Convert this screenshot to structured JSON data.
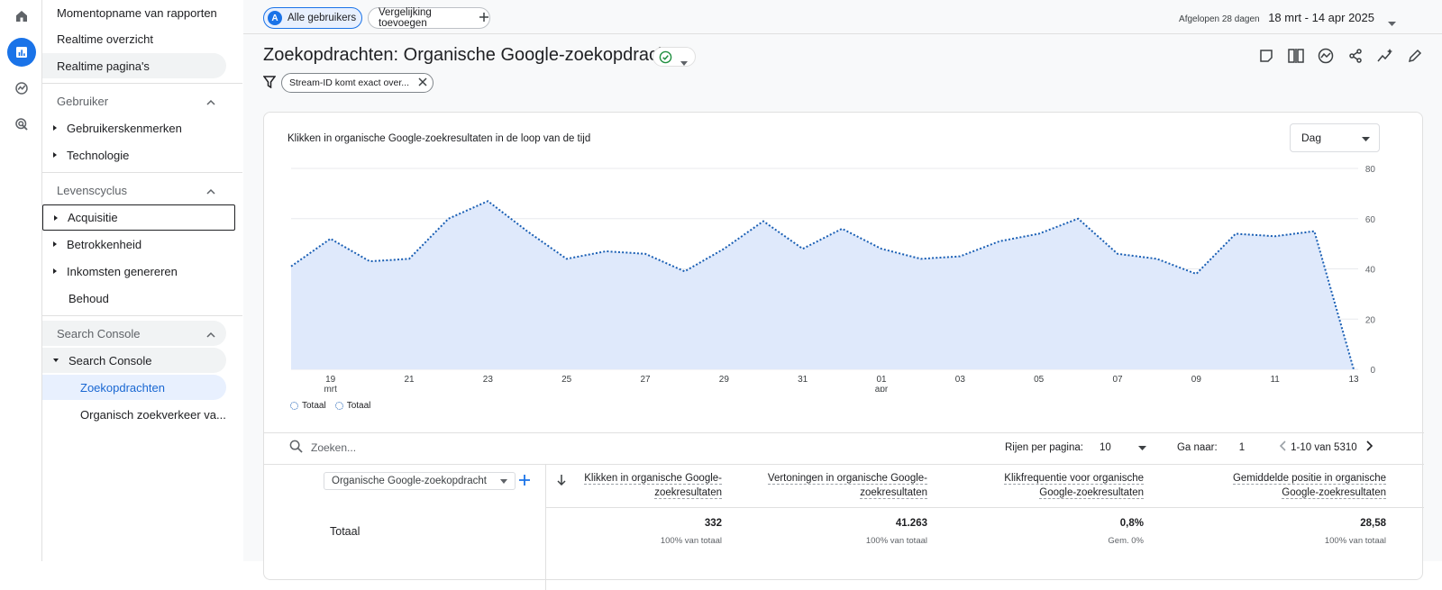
{
  "rail": {
    "icons": [
      "home-icon",
      "reports-icon",
      "explore-icon",
      "advertising-icon"
    ]
  },
  "nav": {
    "top_items": [
      "Momentopname van rapporten",
      "Realtime overzicht",
      "Realtime pagina's"
    ],
    "section_gebruiker": "Gebruiker",
    "gebruiker_items": [
      "Gebruikerskenmerken",
      "Technologie"
    ],
    "section_levenscyclus": "Levenscyclus",
    "levenscyclus_items": [
      "Acquisitie",
      "Betrokkenheid",
      "Inkomsten genereren",
      "Behoud"
    ],
    "section_search_console": "Search Console",
    "sc_parent": "Search Console",
    "sc_items": [
      "Zoekopdrachten",
      "Organisch zoekverkeer va..."
    ]
  },
  "topbar": {
    "all_users_initial": "A",
    "all_users": "Alle gebruikers",
    "add_comparison": "Vergelijking toevoegen",
    "date_prefix": "Afgelopen 28 dagen",
    "date_range": "18 mrt - 14 apr 2025"
  },
  "page": {
    "title": "Zoekopdrachten: Organische Google-zoekopdracht",
    "filter": "Stream-ID komt exact over..."
  },
  "chart_card": {
    "title": "Klikken in organische Google-zoekresultaten in de loop van de tijd",
    "granularity": "Dag",
    "legend": [
      "Totaal",
      "Totaal"
    ]
  },
  "chart_data": {
    "type": "area",
    "title": "Klikken in organische Google-zoekresultaten in de loop van de tijd",
    "xlabel": "",
    "ylabel": "",
    "ylim": [
      0,
      80
    ],
    "y_ticks": [
      "80",
      "60",
      "40",
      "20",
      "0"
    ],
    "x_tick_labels": [
      "19",
      "21",
      "23",
      "25",
      "27",
      "29",
      "31",
      "01",
      "03",
      "05",
      "07",
      "09",
      "11",
      "13"
    ],
    "x_sub_labels": {
      "19": "mrt",
      "01": "apr"
    },
    "x": [
      "2025-03-18",
      "2025-03-19",
      "2025-03-20",
      "2025-03-21",
      "2025-03-22",
      "2025-03-23",
      "2025-03-24",
      "2025-03-25",
      "2025-03-26",
      "2025-03-27",
      "2025-03-28",
      "2025-03-29",
      "2025-03-30",
      "2025-03-31",
      "2025-04-01",
      "2025-04-02",
      "2025-04-03",
      "2025-04-04",
      "2025-04-05",
      "2025-04-06",
      "2025-04-07",
      "2025-04-08",
      "2025-04-09",
      "2025-04-10",
      "2025-04-11",
      "2025-04-12",
      "2025-04-13",
      "2025-04-14"
    ],
    "series": [
      {
        "name": "Totaal",
        "values": [
          41,
          52,
          43,
          44,
          60,
          67,
          55,
          44,
          47,
          46,
          39,
          48,
          59,
          48,
          56,
          48,
          44,
          45,
          51,
          54,
          60,
          46,
          44,
          38,
          54,
          53,
          55,
          0
        ]
      }
    ],
    "grid": true,
    "legend": "bottom-left"
  },
  "table": {
    "search_placeholder": "Zoeken...",
    "rows_per_page_label": "Rijen per pagina:",
    "rows_per_page": "10",
    "goto_label": "Ga naar:",
    "goto_value": "1",
    "range": "1-10 van 5310",
    "dimension": "Organische Google-zoekopdracht",
    "columns": [
      {
        "l1": "Klikken in organische Google-",
        "l2": "zoekresultaten",
        "total": "332",
        "sub": "100% van totaal"
      },
      {
        "l1": "Vertoningen in organische Google-",
        "l2": "zoekresultaten",
        "total": "41.263",
        "sub": "100% van totaal"
      },
      {
        "l1": "Klikfrequentie voor organische",
        "l2": "Google-zoekresultaten",
        "total": "0,8%",
        "sub": "Gem. 0%"
      },
      {
        "l1": "Gemiddelde positie in organische",
        "l2": "Google-zoekresultaten",
        "total": "28,58",
        "sub": "100% van totaal"
      }
    ],
    "total_label": "Totaal"
  }
}
